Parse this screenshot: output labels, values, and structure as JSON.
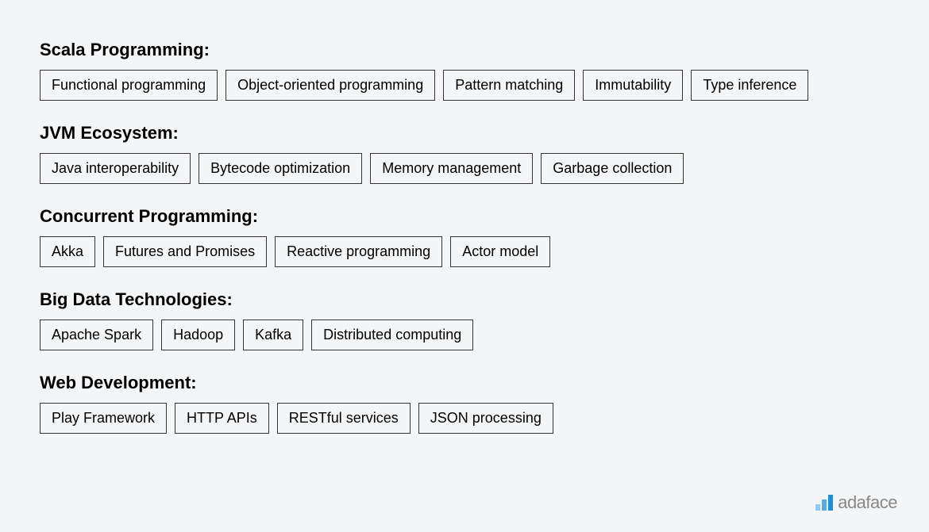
{
  "categories": [
    {
      "title": "Scala Programming:",
      "tags": [
        "Functional programming",
        "Object-oriented programming",
        "Pattern matching",
        "Immutability",
        "Type inference"
      ]
    },
    {
      "title": "JVM Ecosystem:",
      "tags": [
        "Java interoperability",
        "Bytecode optimization",
        "Memory management",
        "Garbage collection"
      ]
    },
    {
      "title": "Concurrent Programming:",
      "tags": [
        "Akka",
        "Futures and Promises",
        "Reactive programming",
        "Actor model"
      ]
    },
    {
      "title": "Big Data Technologies:",
      "tags": [
        "Apache Spark",
        "Hadoop",
        "Kafka",
        "Distributed computing"
      ]
    },
    {
      "title": "Web Development:",
      "tags": [
        "Play Framework",
        "HTTP APIs",
        "RESTful services",
        "JSON processing"
      ]
    }
  ],
  "brand": {
    "name": "adaface"
  }
}
